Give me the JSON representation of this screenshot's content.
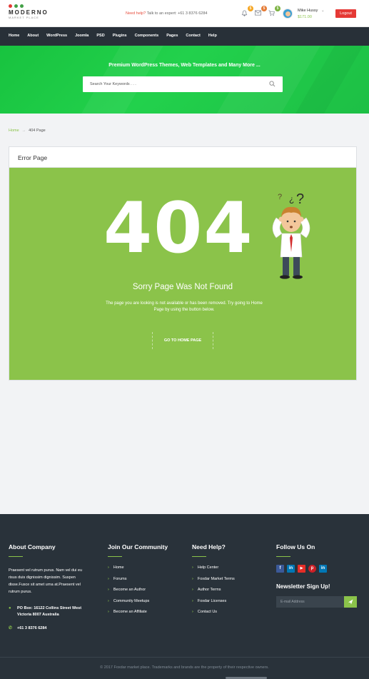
{
  "header": {
    "logo_text": "MODERNO",
    "logo_sub": "MARKET PLACE",
    "logo_dot_colors": [
      "#e53935",
      "#43a047",
      "#43a047"
    ],
    "help_question": "Need help?",
    "help_text": "Talk to an expert: +61 3 8376 6284",
    "notifications_count": "5",
    "messages_count": "5",
    "cart_count": "5",
    "user_name": "Mike Hussy",
    "user_balance": "$171.00",
    "logout_label": "Logout"
  },
  "nav": [
    "Home",
    "About",
    "WordPress",
    "Joomla",
    "PSD",
    "Plugins",
    "Components",
    "Pages",
    "Contact",
    "Help"
  ],
  "hero": {
    "title": "Premium WordPress Themes, Web Templates and Many More ...",
    "search_placeholder": "Search Your Keywords . . ."
  },
  "breadcrumb": {
    "home": "Home",
    "separator": "→",
    "current": "404 Page"
  },
  "error": {
    "panel_title": "Error Page",
    "code": "404",
    "heading": "Sorry Page Was Not Found",
    "description": "The page you are looking is not available or has been removed. Try going to Home Page by using the button below.",
    "button_label": "GO TO HOME PAGE"
  },
  "footer": {
    "about": {
      "heading": "About Company",
      "text": "Praesent vel rutrum purus. Nam vel dui eu risus duis dignissim dignissim. Suspen disse.Fusce sit amet urna at.Praesent vel rutrum purus.",
      "address": "PO Box: 16122 Collins Street West Victoria 8007 Australia",
      "phone": "+61 3 8376 6284"
    },
    "community": {
      "heading": "Join Our Community",
      "links": [
        "Home",
        "Forums",
        "Become an Author",
        "Community Meetups",
        "Become an Affiliate"
      ]
    },
    "help": {
      "heading": "Need Help?",
      "links": [
        "Help Center",
        "Foxdar Market Terms",
        "Author Terms",
        "Foxdar Licenses",
        "Contact Us"
      ]
    },
    "follow": {
      "heading": "Follow Us On",
      "socials": [
        {
          "icon": "facebook-icon",
          "glyph": "f",
          "color": "#3b5998"
        },
        {
          "icon": "linkedin-icon",
          "glyph": "in",
          "color": "#0077b5"
        },
        {
          "icon": "youtube-icon",
          "glyph": "▶",
          "color": "#e52d27"
        },
        {
          "icon": "pinterest-icon",
          "glyph": "p",
          "color": "#cb2027"
        },
        {
          "icon": "linkedin-icon",
          "glyph": "in",
          "color": "#0077b5"
        }
      ],
      "newsletter_heading": "Newsletter Sign Up!",
      "email_placeholder": "E-mail Address"
    },
    "copyright": "© 2017 Foxdar market place. Trademarks and brands are the property of their respective owners."
  },
  "colors": {
    "accent_green": "#8bc34a",
    "hero_green": "#1fc844",
    "nav_bg": "#283038",
    "footer_bg": "#29323a",
    "logout_red": "#e53935"
  }
}
